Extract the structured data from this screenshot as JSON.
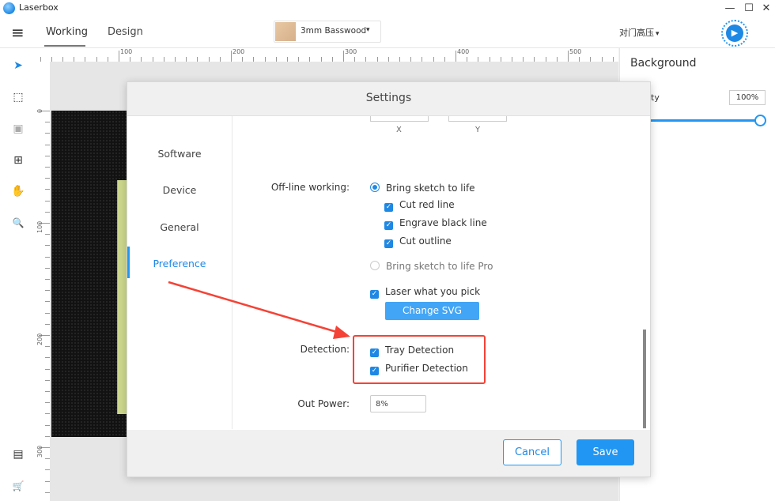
{
  "app": {
    "title": "Laserbox"
  },
  "window_controls": {
    "minimize": "—",
    "maximize": "☐",
    "close": "✕"
  },
  "topbar": {
    "menu_icon": "≡",
    "tabs": [
      {
        "label": "Working",
        "active": true
      },
      {
        "label": "Design",
        "active": false
      }
    ],
    "material": {
      "label": "3mm Basswood",
      "caret": "▾"
    },
    "device": {
      "label": "对门高压",
      "caret": "▾"
    },
    "run_icon": "▶"
  },
  "toolbar": {
    "tools": [
      {
        "name": "select-arrow-icon",
        "glyph": "➤"
      },
      {
        "name": "multi-select-icon",
        "glyph": "⬚"
      },
      {
        "name": "image-icon",
        "glyph": "▣"
      },
      {
        "name": "add-icon",
        "glyph": "⊞"
      },
      {
        "name": "hand-pan-icon",
        "glyph": "✋"
      },
      {
        "name": "zoom-icon",
        "glyph": "🔍"
      }
    ],
    "bottom_tools": [
      {
        "name": "notes-icon",
        "glyph": "▤"
      },
      {
        "name": "cart-icon",
        "glyph": "🛒"
      }
    ]
  },
  "ruler": {
    "top_labels": [
      "100",
      "200",
      "300",
      "400",
      "500"
    ],
    "left_labels": [
      "0",
      "100",
      "200",
      "300"
    ]
  },
  "right_panel": {
    "title": "Background",
    "opacity_label": "ity",
    "opacity_value": "100%"
  },
  "settings": {
    "title": "Settings",
    "nav": [
      {
        "label": "Software",
        "active": false
      },
      {
        "label": "Device",
        "active": false
      },
      {
        "label": "General",
        "active": false
      },
      {
        "label": "Preference",
        "active": true
      }
    ],
    "xy": {
      "x_label": "X",
      "y_label": "Y"
    },
    "offline": {
      "label": "Off-line working:",
      "bring_sketch": "Bring sketch to life",
      "cut_red": "Cut red line",
      "engrave_black": "Engrave black line",
      "cut_outline": "Cut outline",
      "bring_sketch_pro": "Bring sketch to life Pro",
      "laser_pick": "Laser what you pick",
      "change_svg": "Change SVG"
    },
    "detection": {
      "label": "Detection:",
      "tray": "Tray Detection",
      "purifier": "Purifier Detection"
    },
    "out_power": {
      "label": "Out Power:",
      "value": "8%"
    },
    "cancel": "Cancel",
    "save": "Save"
  },
  "colors": {
    "accent": "#2196f3",
    "annotation": "#f44336"
  }
}
